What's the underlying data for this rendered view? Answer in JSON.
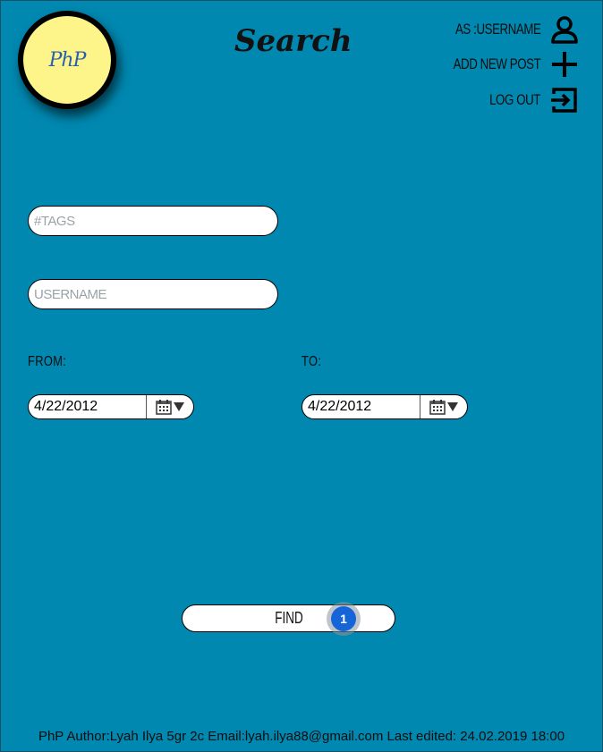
{
  "header": {
    "logo_text": "PhP",
    "title": "Search"
  },
  "menu": {
    "user_label": "AS :USERNAME",
    "add_post_label": "ADD NEW POST",
    "logout_label": "LOG OUT"
  },
  "form": {
    "tags_placeholder": "#TAGS",
    "username_placeholder": "USERNAME",
    "from_label": "FROM:",
    "to_label": "TO:",
    "from_date": "4/22/2012",
    "to_date": "4/22/2012",
    "find_label": "FIND",
    "badge_count": "1"
  },
  "footer": {
    "text": "PhP Author:Lyah Ilya 5gr 2c Email:lyah.ilya88@gmail.com Last edited: 24.02.2019 18:00"
  },
  "colors": {
    "background": "#0088b0",
    "logo_fill": "#fdf58a",
    "badge": "#1565d8"
  }
}
